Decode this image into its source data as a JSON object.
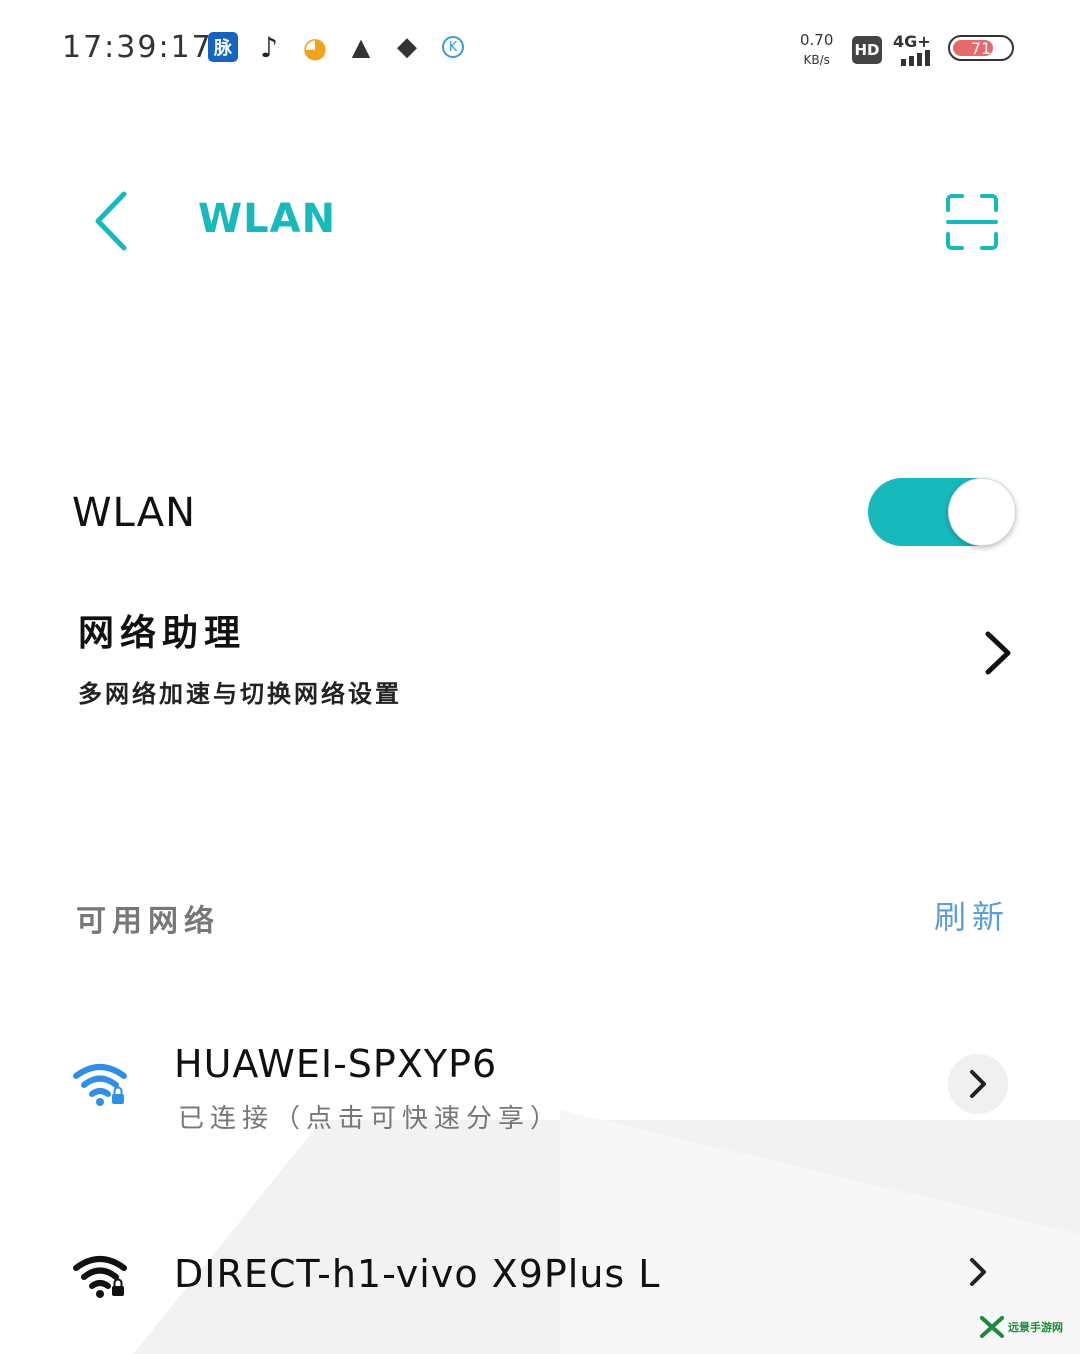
{
  "status_bar": {
    "time": "17:39:17",
    "notification_icons": [
      {
        "name": "mai-app-icon",
        "glyph": "脉"
      },
      {
        "name": "tiktok-icon",
        "glyph": "♪"
      },
      {
        "name": "video-app-icon",
        "glyph": "◕"
      },
      {
        "name": "warning-icon",
        "glyph": "▲"
      },
      {
        "name": "qq-icon",
        "glyph": "◆"
      },
      {
        "name": "k-app-icon",
        "glyph": "K"
      }
    ],
    "speed_value": "0.70",
    "speed_unit": "KB/s",
    "hd_label": "HD",
    "network_label": "4G+",
    "battery_level": "71",
    "battery_color": "#e56b6b"
  },
  "header": {
    "back_icon": "chevron-left-icon",
    "title": "WLAN",
    "scan_icon": "scan-icon",
    "accent": "#17b9bd"
  },
  "wlan_toggle": {
    "label": "WLAN",
    "on": true
  },
  "assistant": {
    "title": "网络助理",
    "subtitle": "多网络加速与切换网络设置"
  },
  "available": {
    "label": "可用网络",
    "refresh_label": "刷新"
  },
  "networks": [
    {
      "ssid": "HUAWEI-SPXYP6",
      "status": "已连接（点击可快速分享）",
      "color": "#2f8ee6",
      "locked": true
    },
    {
      "ssid": "DIRECT-h1-vivo X9Plus L",
      "status": "",
      "color": "#111111",
      "locked": true
    }
  ],
  "watermark": {
    "text": "远景手游网"
  }
}
